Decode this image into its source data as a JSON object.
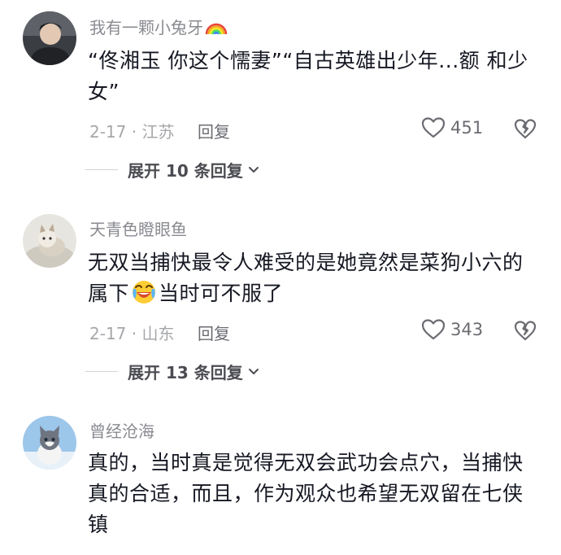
{
  "comments": [
    {
      "username": "我有一颗小兔牙",
      "text_line1": "“佟湘玉 你这个懦妻”“自古英雄出少年...额 和少",
      "text_line2": "女”",
      "meta": "2-17 · 江苏",
      "reply_label": "回复",
      "likes": "451",
      "expand_label": "展开 10 条回复"
    },
    {
      "username": "天青色瞪眼鱼",
      "text_line1": "无双当捕快最令人难受的是她竟然是菜狗小六的",
      "text_line2a": "属下",
      "text_line2b": "当时可不服了",
      "meta": "2-17 · 山东",
      "reply_label": "回复",
      "likes": "343",
      "expand_label": "展开 13 条回复"
    },
    {
      "username": "曾经沧海",
      "text_line1": "真的，当时真是觉得无双会武功会点穴，当捕快",
      "text_line2": "真的合适，而且，作为观众也希望无双留在七侠",
      "text_line3": "镇"
    }
  ],
  "icons": {
    "like": "heart-outline-icon",
    "dislike": "broken-heart-icon",
    "expand": "chevron-down-icon",
    "username_badge": "rainbow-emoji",
    "inline_emoji": "laughing-crying-emoji"
  },
  "colors": {
    "text": "#161823",
    "username": "#8a8b91",
    "meta": "#a6a7ab"
  }
}
